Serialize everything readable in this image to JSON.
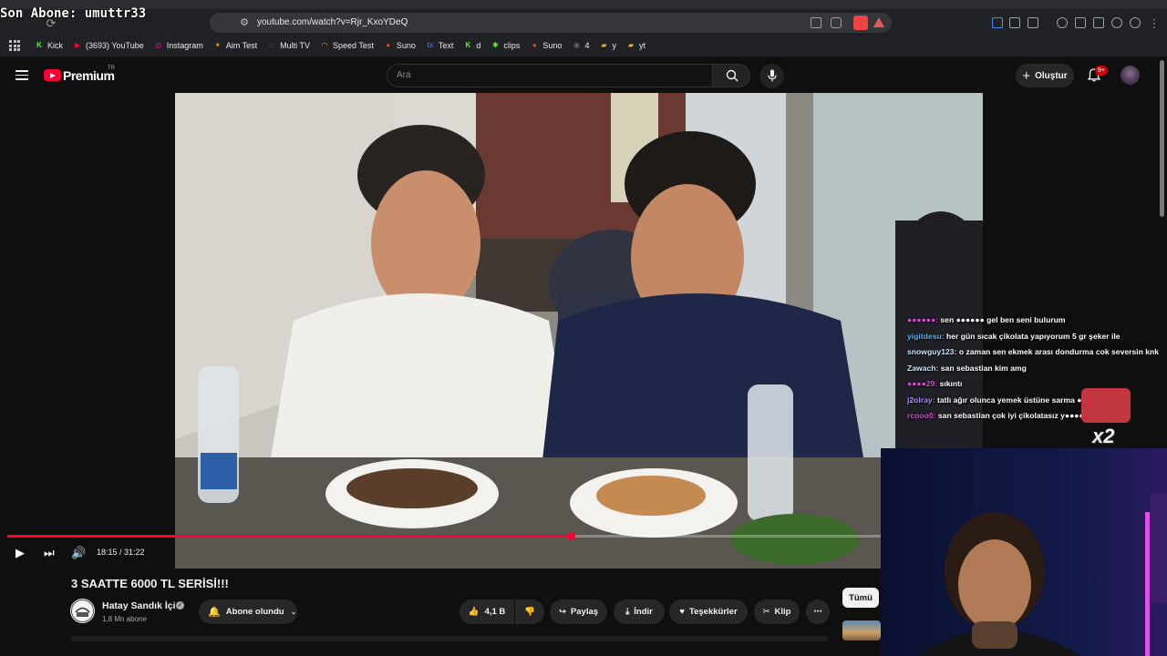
{
  "overlay": {
    "last_subscriber": "Son Abone: umuttr33"
  },
  "browser": {
    "url": "youtube.com/watch?v=Rjr_KxoYDeQ",
    "bookmarks": [
      {
        "label": "Kick",
        "color": "#53fc18",
        "glyph": "K"
      },
      {
        "label": "(3693) YouTube",
        "color": "#ff0033",
        "glyph": "▶"
      },
      {
        "label": "Instagram",
        "color": "#d6249f",
        "glyph": "◎"
      },
      {
        "label": "Aim Test",
        "color": "#f59e0b",
        "glyph": "✦"
      },
      {
        "label": "Multi TV",
        "color": "#444",
        "glyph": "▭"
      },
      {
        "label": "Speed Test",
        "color": "#f4a300",
        "glyph": "◠"
      },
      {
        "label": "Suno",
        "color": "#e0452f",
        "glyph": "●"
      },
      {
        "label": "Text",
        "color": "#4a67c8",
        "glyph": "tx"
      },
      {
        "label": "d",
        "color": "#53fc18",
        "glyph": "K"
      },
      {
        "label": "clips",
        "color": "#53fc18",
        "glyph": "✱"
      },
      {
        "label": "Suno",
        "color": "#e0452f",
        "glyph": "●"
      },
      {
        "label": "4",
        "color": "#666",
        "glyph": "◉"
      },
      {
        "label": "y",
        "color": "#e8b13c",
        "glyph": "▰"
      },
      {
        "label": "yt",
        "color": "#e8b13c",
        "glyph": "▰"
      }
    ]
  },
  "header": {
    "logo_text": "Premium",
    "logo_region": "TR",
    "search_placeholder": "Ara",
    "create_label": "Oluştur",
    "notifications": "9+"
  },
  "player": {
    "current_time": "18:15",
    "duration": "31:22",
    "time_display": "18:15 / 31:22",
    "progress_fraction": 0.582
  },
  "chat": [
    {
      "user": "●●●●●●:",
      "text": "sen ●●●●●● gel ben seni bulurum",
      "color": "#d24fd2"
    },
    {
      "user": "yigitdesu:",
      "text": "her gün sıcak çikolata yapıyorum 5 gr şeker ile",
      "color": "#5fb4e8"
    },
    {
      "user": "snowguy123:",
      "text": "o zaman sen ekmek arası dondurma cok seversin knk",
      "color": "#c8e8ff"
    },
    {
      "user": "Zawach:",
      "text": "san sebastian kim amg",
      "color": "#c8e8ff"
    },
    {
      "user": "●●●●29:",
      "text": "sıkıntı",
      "color": "#d24fd2"
    },
    {
      "user": "j2olray:",
      "text": "tatlı ağır olunca yemek üstüne sarma ●●●●●yiyo",
      "color": "#b48cff"
    },
    {
      "user": "rcooo0:",
      "text": "san sebastian çok iyi çikolatasız y●●●●● oldum",
      "color": "#d24fd2"
    }
  ],
  "sticker": {
    "multiplier": "x2"
  },
  "video": {
    "title": "3 SAATTE 6000 TL SERİSİ!!!",
    "channel": "Hatay Sandık İçi",
    "subscribers": "1,8 Mn abone",
    "subscribe_label": "Abone olundu",
    "likes": "4,1 B",
    "share_label": "Paylaş",
    "download_label": "İndir",
    "thanks_label": "Teşekkürler",
    "clip_label": "Klip",
    "filter_all": "Tümü"
  },
  "colors": {
    "accent": "#ff0033",
    "background": "#0f0f0f",
    "pill": "#272727"
  }
}
